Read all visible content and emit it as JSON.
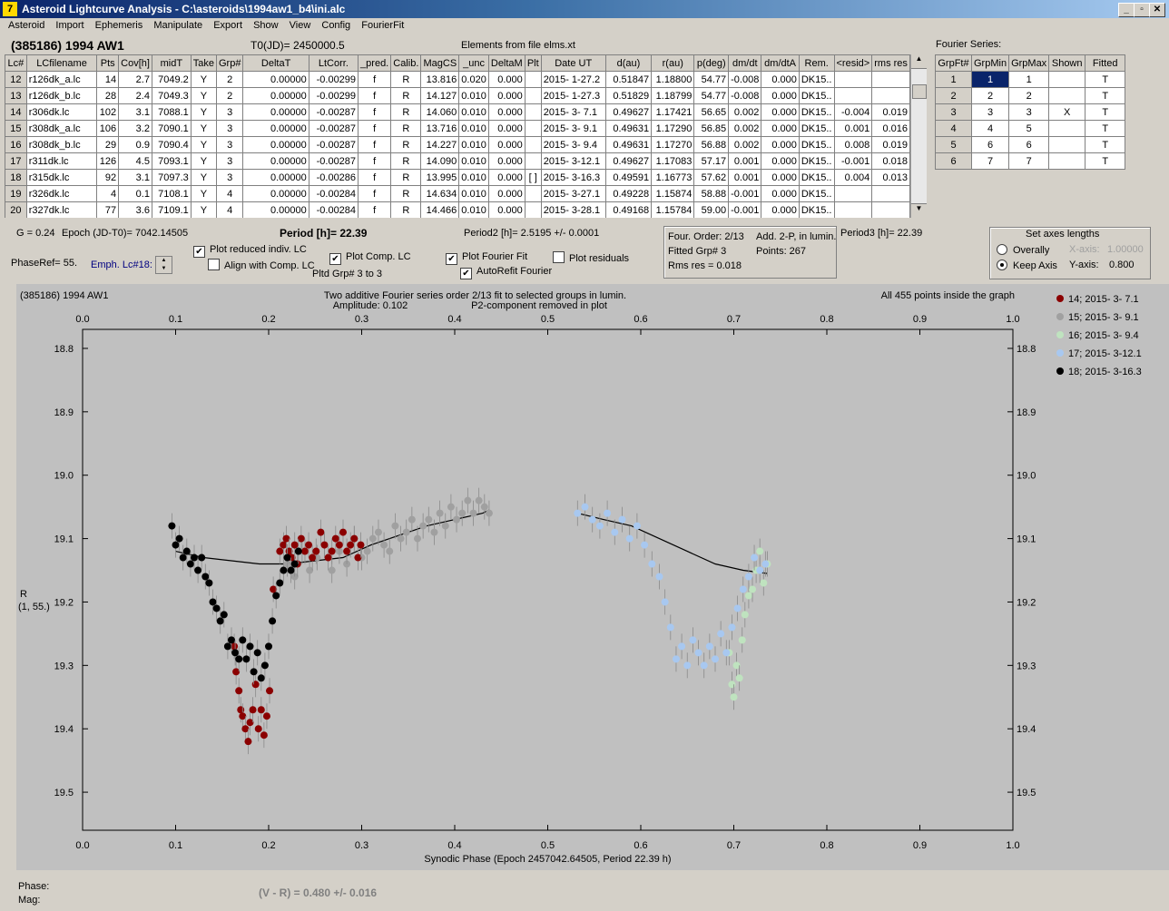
{
  "window": {
    "title": "Asteroid Lightcurve Analysis - C:\\asteroids\\1994aw1_b4\\ini.alc",
    "icon_char": "7"
  },
  "menu": [
    "Asteroid",
    "Import",
    "Ephemeris",
    "Manipulate",
    "Export",
    "Show",
    "View",
    "Config",
    "FourierFit"
  ],
  "header": {
    "object": "(385186) 1994 AW1",
    "t0": "T0(JD)= 2450000.5",
    "elements": "Elements from file elms.xt"
  },
  "lc_table": {
    "columns": [
      "Lc#",
      "LCfilename",
      "Pts",
      "Cov[h]",
      "midT",
      "Take",
      "Grp#",
      "DeltaT",
      "LtCorr.",
      "_pred.",
      "Calib.",
      "MagCS",
      "_unc",
      "DeltaM",
      "Plt",
      "Date UT",
      "d(au)",
      "r(au)",
      "p(deg)",
      "dm/dt",
      "dm/dtA",
      "Rem.",
      "<resid>",
      "rms res"
    ],
    "rows": [
      [
        "12",
        "r126dk_a.lc",
        "14",
        "2.7",
        "7049.2",
        "Y",
        "2",
        "0.00000",
        "-0.00299",
        "f",
        "R",
        "13.816",
        "0.020",
        "0.000",
        "",
        "2015- 1-27.2",
        "0.51847",
        "1.18800",
        "54.77",
        "-0.008",
        "0.000",
        "DK15..",
        "",
        ""
      ],
      [
        "13",
        "r126dk_b.lc",
        "28",
        "2.4",
        "7049.3",
        "Y",
        "2",
        "0.00000",
        "-0.00299",
        "f",
        "R",
        "14.127",
        "0.010",
        "0.000",
        "",
        "2015- 1-27.3",
        "0.51829",
        "1.18799",
        "54.77",
        "-0.008",
        "0.000",
        "DK15..",
        "",
        ""
      ],
      [
        "14",
        "r306dk.lc",
        "102",
        "3.1",
        "7088.1",
        "Y",
        "3",
        "0.00000",
        "-0.00287",
        "f",
        "R",
        "14.060",
        "0.010",
        "0.000",
        "",
        "2015- 3- 7.1",
        "0.49627",
        "1.17421",
        "56.65",
        "0.002",
        "0.000",
        "DK15..",
        "-0.004",
        "0.019"
      ],
      [
        "15",
        "r308dk_a.lc",
        "106",
        "3.2",
        "7090.1",
        "Y",
        "3",
        "0.00000",
        "-0.00287",
        "f",
        "R",
        "13.716",
        "0.010",
        "0.000",
        "",
        "2015- 3- 9.1",
        "0.49631",
        "1.17290",
        "56.85",
        "0.002",
        "0.000",
        "DK15..",
        "0.001",
        "0.016"
      ],
      [
        "16",
        "r308dk_b.lc",
        "29",
        "0.9",
        "7090.4",
        "Y",
        "3",
        "0.00000",
        "-0.00287",
        "f",
        "R",
        "14.227",
        "0.010",
        "0.000",
        "",
        "2015- 3- 9.4",
        "0.49631",
        "1.17270",
        "56.88",
        "0.002",
        "0.000",
        "DK15..",
        "0.008",
        "0.019"
      ],
      [
        "17",
        "r311dk.lc",
        "126",
        "4.5",
        "7093.1",
        "Y",
        "3",
        "0.00000",
        "-0.00287",
        "f",
        "R",
        "14.090",
        "0.010",
        "0.000",
        "",
        "2015- 3-12.1",
        "0.49627",
        "1.17083",
        "57.17",
        "0.001",
        "0.000",
        "DK15..",
        "-0.001",
        "0.018"
      ],
      [
        "18",
        "r315dk.lc",
        "92",
        "3.1",
        "7097.3",
        "Y",
        "3",
        "0.00000",
        "-0.00286",
        "f",
        "R",
        "13.995",
        "0.010",
        "0.000",
        "[ ]",
        "2015- 3-16.3",
        "0.49591",
        "1.16773",
        "57.62",
        "0.001",
        "0.000",
        "DK15..",
        "0.004",
        "0.013"
      ],
      [
        "19",
        "r326dk.lc",
        "4",
        "0.1",
        "7108.1",
        "Y",
        "4",
        "0.00000",
        "-0.00284",
        "f",
        "R",
        "14.634",
        "0.010",
        "0.000",
        "",
        "2015- 3-27.1",
        "0.49228",
        "1.15874",
        "58.88",
        "-0.001",
        "0.000",
        "DK15..",
        "",
        ""
      ],
      [
        "20",
        "r327dk.lc",
        "77",
        "3.6",
        "7109.1",
        "Y",
        "4",
        "0.00000",
        "-0.00284",
        "f",
        "R",
        "14.466",
        "0.010",
        "0.000",
        "",
        "2015- 3-28.1",
        "0.49168",
        "1.15784",
        "59.00",
        "-0.001",
        "0.000",
        "DK15..",
        "",
        ""
      ]
    ]
  },
  "fourier": {
    "title": "Fourier Series:",
    "columns": [
      "GrpFt#",
      "GrpMin",
      "GrpMax",
      "Shown",
      "Fitted"
    ],
    "rows": [
      [
        "1",
        "1",
        "1",
        "",
        "T"
      ],
      [
        "2",
        "2",
        "2",
        "",
        "T"
      ],
      [
        "3",
        "3",
        "3",
        "X",
        "T"
      ],
      [
        "4",
        "4",
        "5",
        "",
        "T"
      ],
      [
        "5",
        "6",
        "6",
        "",
        "T"
      ],
      [
        "6",
        "7",
        "7",
        "",
        "T"
      ]
    ]
  },
  "controls": {
    "g": "G = 0.24",
    "epoch": "Epoch (JD-T0)= 7042.14505",
    "period": "Period [h]= 22.39",
    "period2": "Period2 [h]= 2.5195 +/- 0.0001",
    "period3": "Period3 [h]= 22.39",
    "phaseref": "PhaseRef= 55.",
    "emph": "Emph. Lc#18:",
    "plot_reduced": "Plot reduced indiv. LC",
    "align": "Align with Comp. LC",
    "plot_comp": "Plot Comp. LC",
    "pltd_grp": "Pltd Grp#  3   to   3",
    "plot_fourier": "Plot Fourier Fit",
    "autorefit": "AutoRefit Fourier",
    "plot_residuals": "Plot residuals",
    "check_mark": "✔",
    "four_order": "Four. Order:  2/13",
    "add": "Add. 2-P, in lumin.",
    "fitted_grp": "Fitted Grp# 3",
    "points": "Points: 267",
    "rms": "Rms res    = 0.018",
    "axes_title": "Set axes lengths",
    "overally": "Overally",
    "keep_axis": "Keep Axis",
    "x_axis_label": "X-axis:",
    "x_axis_val": "1.00000",
    "y_axis_label": "Y-axis:",
    "y_axis_val": "0.800"
  },
  "chart_data": {
    "type": "scatter",
    "title": "Two additive Fourier series order 2/13 fit to selected groups in lumin.",
    "subtitle_left": "Amplitude: 0.102",
    "subtitle_right": "P2-component removed in plot",
    "object_label": "(385186) 1994 AW1",
    "points_note": "All 455 points inside the graph",
    "xlabel": "Synodic Phase (Epoch 2457042.64505, Period 22.39 h)",
    "ylabel": "R",
    "ylabel2": "(1, 55.)",
    "xlim": [
      0,
      1
    ],
    "ylim": [
      19.56,
      18.77
    ],
    "y_reversed": true,
    "x_ticks": [
      "0.0",
      "0.1",
      "0.2",
      "0.3",
      "0.4",
      "0.5",
      "0.6",
      "0.7",
      "0.8",
      "0.9",
      "1.0"
    ],
    "y_ticks": [
      "18.8",
      "18.9",
      "19.0",
      "19.1",
      "19.2",
      "19.3",
      "19.4",
      "19.5"
    ],
    "background": "#c0c0c0",
    "series": [
      {
        "name": "14; 2015- 3- 7.1",
        "color": "#8b0000",
        "x": [
          0.163,
          0.165,
          0.168,
          0.17,
          0.172,
          0.175,
          0.178,
          0.18,
          0.183,
          0.186,
          0.189,
          0.192,
          0.195,
          0.198,
          0.201,
          0.205,
          0.212,
          0.216,
          0.219,
          0.222,
          0.225,
          0.228,
          0.231,
          0.235,
          0.239,
          0.243,
          0.247,
          0.251,
          0.256,
          0.26,
          0.264,
          0.268,
          0.272,
          0.276,
          0.28,
          0.284,
          0.288,
          0.292,
          0.296,
          0.299
        ],
        "y": [
          19.27,
          19.31,
          19.34,
          19.37,
          19.38,
          19.4,
          19.42,
          19.39,
          19.37,
          19.33,
          19.4,
          19.37,
          19.41,
          19.38,
          19.34,
          19.18,
          19.12,
          19.11,
          19.1,
          19.12,
          19.13,
          19.11,
          19.14,
          19.1,
          19.12,
          19.11,
          19.13,
          19.12,
          19.09,
          19.11,
          19.13,
          19.12,
          19.1,
          19.11,
          19.09,
          19.12,
          19.11,
          19.1,
          19.13,
          19.11
        ]
      },
      {
        "name": "15; 2015- 3- 9.1",
        "color": "#a0a0a0",
        "x": [
          0.22,
          0.228,
          0.236,
          0.244,
          0.252,
          0.26,
          0.268,
          0.276,
          0.284,
          0.292,
          0.3,
          0.306,
          0.312,
          0.318,
          0.324,
          0.33,
          0.336,
          0.342,
          0.348,
          0.354,
          0.36,
          0.366,
          0.372,
          0.378,
          0.384,
          0.39,
          0.396,
          0.402,
          0.408,
          0.414,
          0.42,
          0.426,
          0.432,
          0.437
        ],
        "y": [
          19.14,
          19.16,
          19.12,
          19.15,
          19.13,
          19.11,
          19.15,
          19.12,
          19.14,
          19.1,
          19.13,
          19.12,
          19.1,
          19.09,
          19.11,
          19.12,
          19.08,
          19.1,
          19.09,
          19.07,
          19.1,
          19.08,
          19.07,
          19.09,
          19.06,
          19.08,
          19.05,
          19.07,
          19.06,
          19.04,
          19.06,
          19.04,
          19.05,
          19.06
        ]
      },
      {
        "name": "16; 2015- 3- 9.4",
        "color": "#bfe3bf",
        "x": [
          0.695,
          0.698,
          0.7,
          0.703,
          0.706,
          0.709,
          0.712,
          0.716,
          0.72,
          0.724,
          0.728,
          0.732,
          0.736
        ],
        "y": [
          19.28,
          19.33,
          19.35,
          19.3,
          19.32,
          19.26,
          19.22,
          19.19,
          19.18,
          19.15,
          19.12,
          19.17,
          19.14
        ]
      },
      {
        "name": "17; 2015- 3-12.1",
        "color": "#a8c8f0",
        "x": [
          0.532,
          0.54,
          0.548,
          0.556,
          0.564,
          0.572,
          0.58,
          0.588,
          0.596,
          0.604,
          0.612,
          0.62,
          0.626,
          0.632,
          0.638,
          0.644,
          0.65,
          0.656,
          0.662,
          0.668,
          0.674,
          0.68,
          0.686,
          0.692,
          0.698,
          0.704,
          0.71,
          0.716,
          0.722,
          0.728,
          0.734
        ],
        "y": [
          19.06,
          19.05,
          19.07,
          19.08,
          19.06,
          19.09,
          19.07,
          19.1,
          19.08,
          19.11,
          19.14,
          19.16,
          19.2,
          19.24,
          19.29,
          19.27,
          19.3,
          19.26,
          19.28,
          19.3,
          19.27,
          19.29,
          19.25,
          19.28,
          19.24,
          19.21,
          19.18,
          19.16,
          19.13,
          19.15,
          19.14
        ]
      },
      {
        "name": "18; 2015- 3-16.3",
        "color": "#000000",
        "x": [
          0.096,
          0.1,
          0.104,
          0.108,
          0.112,
          0.116,
          0.12,
          0.124,
          0.128,
          0.132,
          0.136,
          0.14,
          0.144,
          0.148,
          0.152,
          0.156,
          0.16,
          0.164,
          0.168,
          0.172,
          0.176,
          0.18,
          0.184,
          0.188,
          0.192,
          0.196,
          0.2,
          0.204,
          0.208,
          0.212,
          0.216,
          0.22,
          0.224,
          0.228,
          0.232
        ],
        "y": [
          19.08,
          19.11,
          19.1,
          19.13,
          19.12,
          19.14,
          19.13,
          19.15,
          19.13,
          19.16,
          19.17,
          19.2,
          19.21,
          19.23,
          19.22,
          19.27,
          19.26,
          19.28,
          19.29,
          19.26,
          19.29,
          19.27,
          19.31,
          19.28,
          19.32,
          19.3,
          19.27,
          19.23,
          19.19,
          19.17,
          19.15,
          19.13,
          19.15,
          19.14,
          19.12
        ]
      }
    ],
    "fit_curves": [
      {
        "x": [
          0.1,
          0.13,
          0.16,
          0.19,
          0.22,
          0.25,
          0.28,
          0.31,
          0.34,
          0.37,
          0.4,
          0.43,
          0.437
        ],
        "y": [
          19.12,
          19.13,
          19.135,
          19.14,
          19.14,
          19.135,
          19.13,
          19.11,
          19.095,
          19.08,
          19.07,
          19.06,
          19.055
        ]
      },
      {
        "x": [
          0.532,
          0.56,
          0.59,
          0.62,
          0.65,
          0.68,
          0.71,
          0.736
        ],
        "y": [
          19.06,
          19.07,
          19.08,
          19.1,
          19.12,
          19.14,
          19.15,
          19.155
        ]
      }
    ]
  },
  "status": {
    "phase_label": "Phase:",
    "mag_label": "Mag:",
    "color_index": "(V - R) = 0.480 +/- 0.016"
  }
}
